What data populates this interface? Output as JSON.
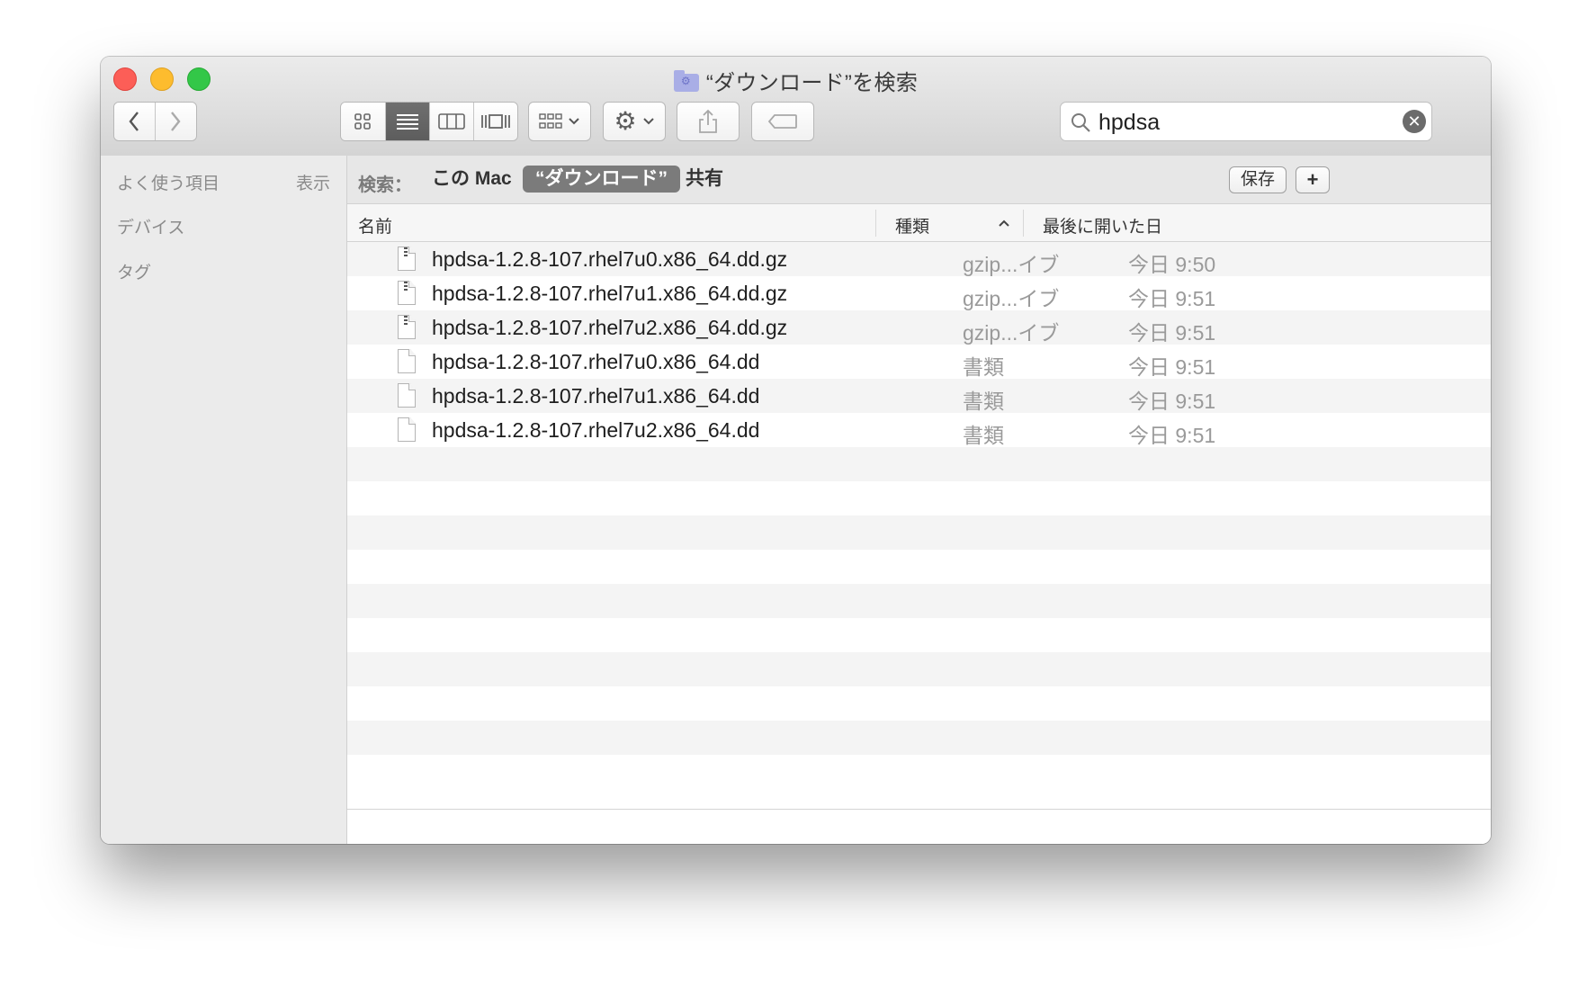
{
  "window": {
    "title": "“ダウンロード”を検索"
  },
  "toolbar": {
    "back_icon": "chevron-left-icon",
    "forward_icon": "chevron-right-icon",
    "view_modes": [
      "icon-view",
      "list-view",
      "column-view",
      "cover-flow-view"
    ],
    "active_view": "list-view",
    "share_icon": "share-icon",
    "tag_icon": "tag-icon"
  },
  "search": {
    "value": "hpdsa",
    "placeholder": "検索"
  },
  "sidebar": {
    "favorites": "よく使う項目",
    "show": "表示",
    "devices": "デバイス",
    "tags": "タグ"
  },
  "scope": {
    "label": "検索：",
    "this_mac": "この Mac",
    "downloads": "“ダウンロード”",
    "shared": "共有",
    "save": "保存",
    "add": "+"
  },
  "columns": {
    "name": "名前",
    "kind": "種類",
    "date": "最後に開いた日"
  },
  "files": [
    {
      "name": "hpdsa-1.2.8-107.rhel7u0.x86_64.dd.gz",
      "kind": "gzip...イブ",
      "date": "今日 9:50",
      "zip": true
    },
    {
      "name": "hpdsa-1.2.8-107.rhel7u1.x86_64.dd.gz",
      "kind": "gzip...イブ",
      "date": "今日 9:51",
      "zip": true
    },
    {
      "name": "hpdsa-1.2.8-107.rhel7u2.x86_64.dd.gz",
      "kind": "gzip...イブ",
      "date": "今日 9:51",
      "zip": true
    },
    {
      "name": "hpdsa-1.2.8-107.rhel7u0.x86_64.dd",
      "kind": "書類",
      "date": "今日 9:51",
      "zip": false
    },
    {
      "name": "hpdsa-1.2.8-107.rhel7u1.x86_64.dd",
      "kind": "書類",
      "date": "今日 9:51",
      "zip": false
    },
    {
      "name": "hpdsa-1.2.8-107.rhel7u2.x86_64.dd",
      "kind": "書類",
      "date": "今日 9:51",
      "zip": false
    }
  ]
}
